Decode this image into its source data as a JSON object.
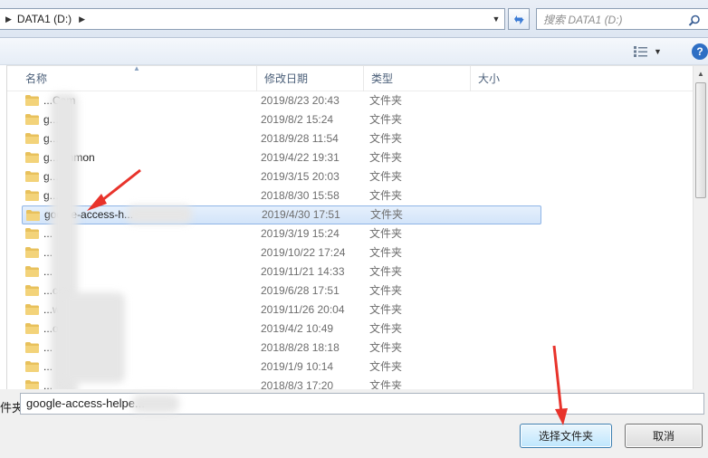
{
  "address": {
    "path": "DATA1 (D:)",
    "search_placeholder": "搜索 DATA1 (D:)"
  },
  "columns": {
    "name": "名称",
    "date": "修改日期",
    "type": "类型",
    "size": "大小"
  },
  "rows": [
    {
      "name": "...Cam",
      "date": "2019/8/23 20:43",
      "type": "文件夹"
    },
    {
      "name": "g...",
      "date": "2019/8/2 15:24",
      "type": "文件夹"
    },
    {
      "name": "g...ub",
      "date": "2018/9/28 11:54",
      "type": "文件夹"
    },
    {
      "name": "g...ommon",
      "date": "2019/4/22 19:31",
      "type": "文件夹"
    },
    {
      "name": "g...s",
      "date": "2019/3/15 20:03",
      "type": "文件夹"
    },
    {
      "name": "g...ng",
      "date": "2018/8/30 15:58",
      "type": "文件夹"
    },
    {
      "name": "google-access-h...",
      "date": "2019/4/30 17:51",
      "type": "文件夹",
      "selected": true
    },
    {
      "name": "...",
      "date": "2019/3/19 15:24",
      "type": "文件夹"
    },
    {
      "name": "...",
      "date": "2019/10/22 17:24",
      "type": "文件夹"
    },
    {
      "name": "...",
      "date": "2019/11/21 14:33",
      "type": "文件夹"
    },
    {
      "name": "...ck",
      "date": "2019/6/28 17:51",
      "type": "文件夹"
    },
    {
      "name": "...w",
      "date": "2019/11/26 20:04",
      "type": "文件夹"
    },
    {
      "name": "...o",
      "date": "2019/4/2 10:49",
      "type": "文件夹"
    },
    {
      "name": "...",
      "date": "2018/8/28 18:18",
      "type": "文件夹"
    },
    {
      "name": "...",
      "date": "2019/1/9 10:14",
      "type": "文件夹"
    },
    {
      "name": "...",
      "date": "2018/8/3 17:20",
      "type": "文件夹"
    }
  ],
  "folder_field": {
    "label": "件夹:",
    "value": "google-access-helpe..."
  },
  "buttons": {
    "select_folder": "选择文件夹",
    "cancel": "取消"
  },
  "colors": {
    "selection": "#d3e4f9",
    "selection_border": "#8fb5e6",
    "annotation_arrow": "#e8332b",
    "folder": "#e8c15c"
  }
}
